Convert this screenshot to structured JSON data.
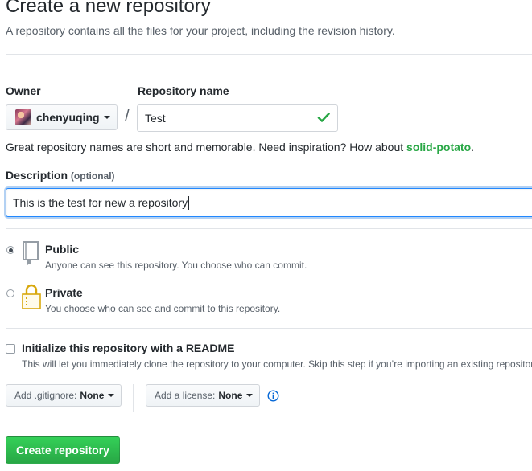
{
  "header": {
    "title": "Create a new repository",
    "subtitle": "A repository contains all the files for your project, including the revision history."
  },
  "owner": {
    "label": "Owner",
    "value": "chenyuqing",
    "icon": "avatar",
    "dropdown_icon": "caret-down-icon"
  },
  "separator": "/",
  "repo_name": {
    "label": "Repository name",
    "value": "Test",
    "status_icon": "check-icon",
    "status_color": "#28a745"
  },
  "name_hint": {
    "prefix": "Great repository names are short and memorable. Need inspiration? How about ",
    "suggestion": "solid-potato",
    "suffix": "."
  },
  "description": {
    "label": "Description",
    "optional": "(optional)",
    "value": "This is the test for new a repository"
  },
  "visibility": {
    "selected": "public",
    "options": [
      {
        "id": "public",
        "title": "Public",
        "note": "Anyone can see this repository. You choose who can commit.",
        "icon": "repo-book-icon",
        "checked": true
      },
      {
        "id": "private",
        "title": "Private",
        "note": "You choose who can see and commit to this repository.",
        "icon": "lock-icon",
        "checked": false
      }
    ]
  },
  "readme": {
    "checked": false,
    "title": "Initialize this repository with a README",
    "note": "This will let you immediately clone the repository to your computer. Skip this step if you’re importing an existing repository."
  },
  "gitignore": {
    "label": "Add .gitignore:",
    "value": "None"
  },
  "license": {
    "label": "Add a license:",
    "value": "None",
    "info_icon": "info-icon"
  },
  "submit": {
    "label": "Create repository",
    "color": "#28a745"
  }
}
